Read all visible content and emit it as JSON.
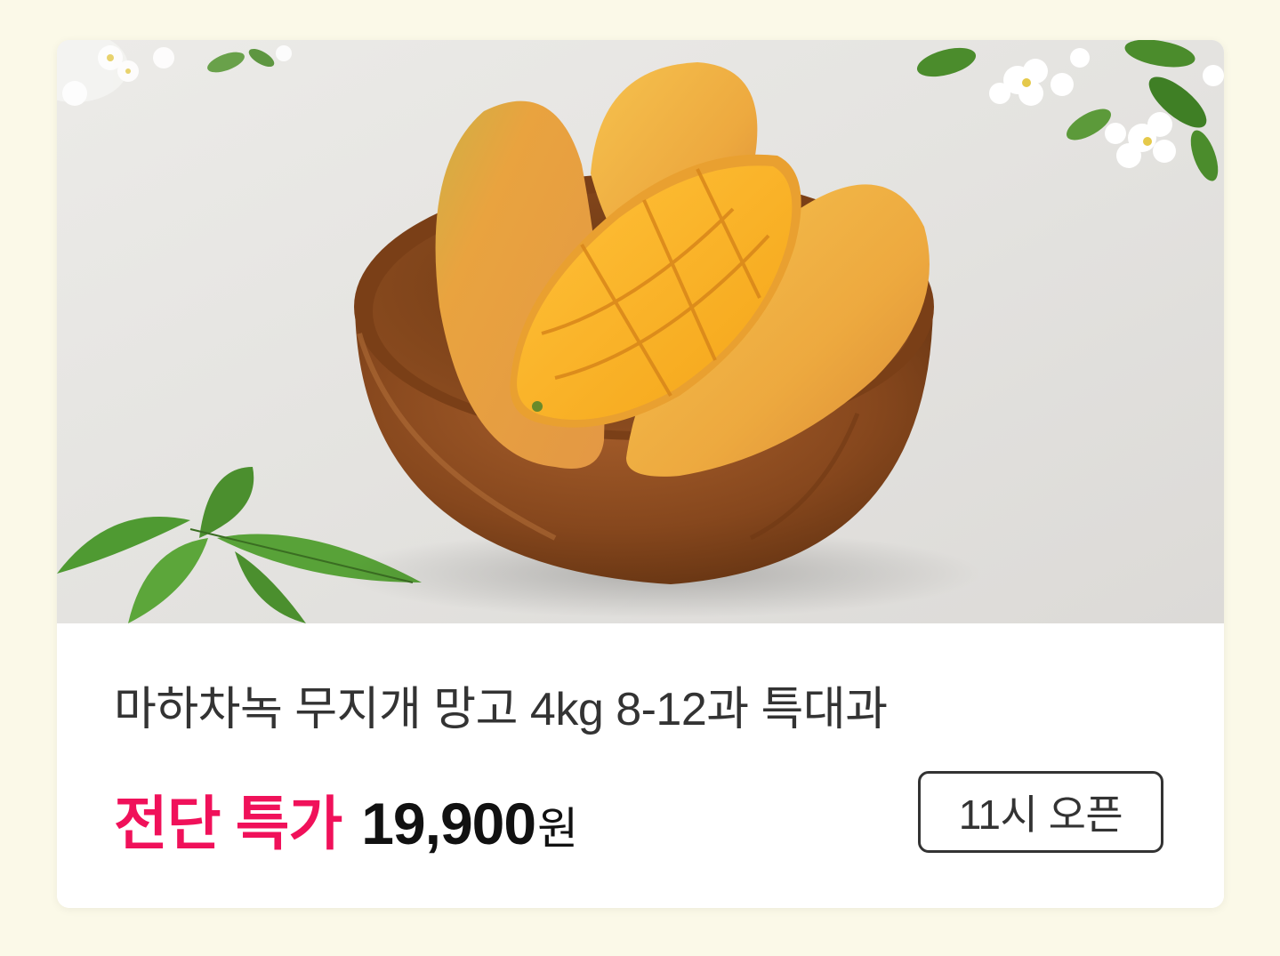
{
  "product": {
    "image_alt": "마하차녹 무지개 망고",
    "name": "마하차녹 무지개 망고 4kg 8-12과 특대과",
    "deal_label": "전단 특가",
    "price": "19,900",
    "price_unit": "원"
  },
  "action": {
    "open_label": "11시 오픈"
  },
  "colors": {
    "accent": "#f0115a",
    "background": "#fbf9e8"
  }
}
